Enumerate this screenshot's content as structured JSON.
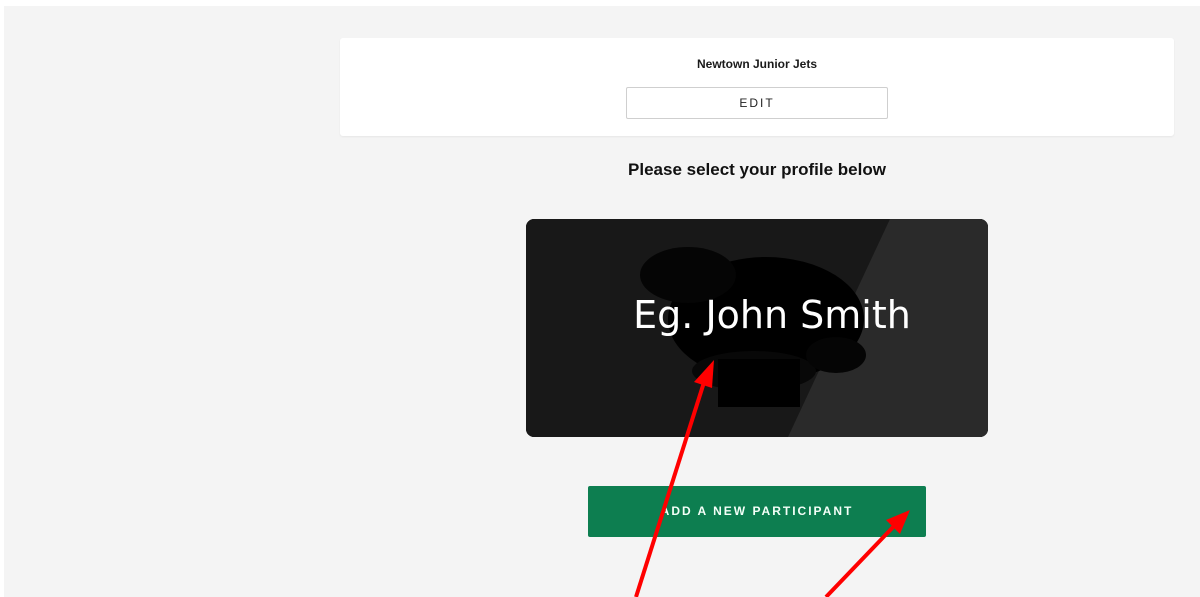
{
  "club": {
    "name": "Newtown Junior Jets",
    "edit_label": "EDIT"
  },
  "profile_section": {
    "heading": "Please select your profile below"
  },
  "profile_card": {
    "name_placeholder": "Eg. John Smith",
    "card_color": "#181818",
    "highlight_color": "#2a2a2a"
  },
  "actions": {
    "add_participant_label": "ADD A NEW PARTICIPANT",
    "accent_color": "#0d7e50"
  },
  "annotations": {
    "arrow_color": "#ff0000"
  }
}
